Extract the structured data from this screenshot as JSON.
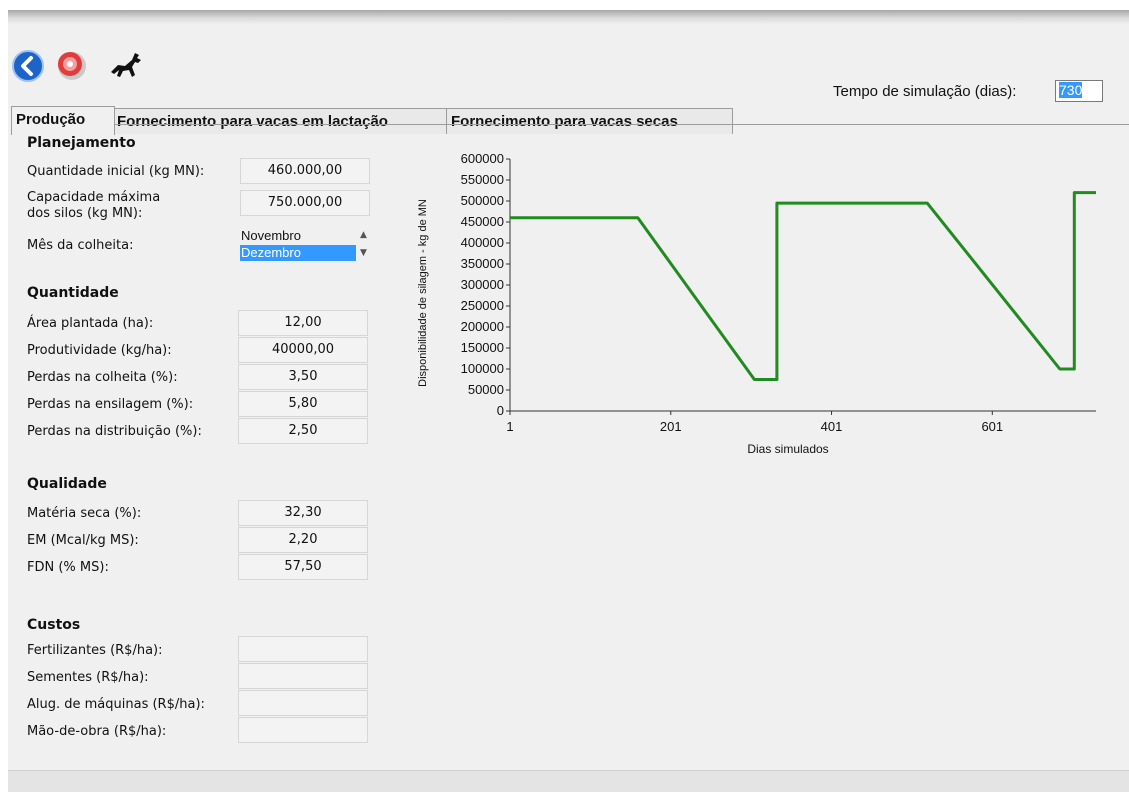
{
  "toolbar": {
    "back_icon": "back-arrow-icon",
    "disc_icon": "disc-icon",
    "horse_icon": "horse-icon"
  },
  "simulation": {
    "label": "Tempo de simulação (dias):",
    "value": "730"
  },
  "tabs": [
    {
      "label": "Produção",
      "active": true
    },
    {
      "label": "Fornecimento para vacas em lactação",
      "active": false
    },
    {
      "label": "Fornecimento para vacas secas",
      "active": false
    }
  ],
  "planejamento": {
    "title": "Planejamento",
    "qtd_inicial_label": "Quantidade inicial (kg MN):",
    "qtd_inicial_value": "460.000,00",
    "cap_label_1": "Capacidade máxima",
    "cap_label_2": "dos silos (kg MN):",
    "cap_value": "750.000,00",
    "mes_label": "Mês da colheita:",
    "mes_options": [
      "Novembro",
      "Dezembro"
    ],
    "mes_selected": "Dezembro"
  },
  "quantidade": {
    "title": "Quantidade",
    "fields": [
      {
        "label": "Área plantada (ha):",
        "value": "12,00"
      },
      {
        "label": "Produtividade (kg/ha):",
        "value": "40000,00"
      },
      {
        "label": "Perdas na colheita (%):",
        "value": "3,50"
      },
      {
        "label": "Perdas na ensilagem (%):",
        "value": "5,80"
      },
      {
        "label": "Perdas na distribuição (%):",
        "value": "2,50"
      }
    ]
  },
  "qualidade": {
    "title": "Qualidade",
    "fields": [
      {
        "label": "Matéria seca (%):",
        "value": "32,30"
      },
      {
        "label": "EM (Mcal/kg MS):",
        "value": "2,20"
      },
      {
        "label": "FDN (% MS):",
        "value": "57,50"
      }
    ]
  },
  "custos": {
    "title": "Custos",
    "fields": [
      {
        "label": "Fertilizantes  (R$/ha):",
        "value": ""
      },
      {
        "label": "Sementes (R$/ha):",
        "value": ""
      },
      {
        "label": "Alug. de máquinas (R$/ha):",
        "value": ""
      },
      {
        "label": "Mão-de-obra (R$/ha):",
        "value": ""
      }
    ]
  },
  "chart_data": {
    "type": "line",
    "title": "",
    "xlabel": "Dias simulados",
    "ylabel": "Disponibilidade de silagem - kg de MN",
    "xlim": [
      1,
      730
    ],
    "ylim": [
      0,
      600000
    ],
    "x_ticks": [
      "1",
      "201",
      "401",
      "601"
    ],
    "y_ticks": [
      "0",
      "50000",
      "100000",
      "150000",
      "200000",
      "250000",
      "300000",
      "350000",
      "400000",
      "450000",
      "500000",
      "550000",
      "600000"
    ],
    "series": [
      {
        "color": "#218a21",
        "x": [
          1,
          160,
          305,
          333,
          333,
          520,
          685,
          703,
          703,
          730
        ],
        "y": [
          460000,
          460000,
          75000,
          75000,
          495000,
          495000,
          100000,
          100000,
          520000,
          520000
        ]
      }
    ],
    "grid": false
  }
}
